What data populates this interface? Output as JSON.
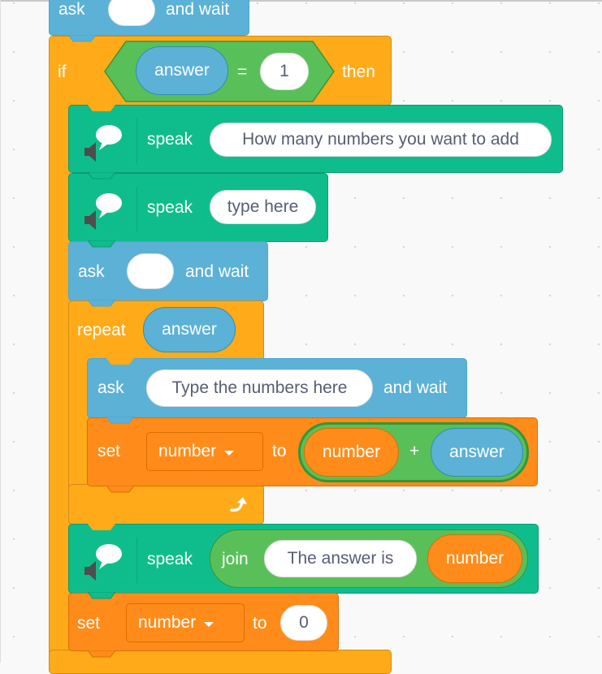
{
  "canvas": {
    "name": "Scratch code area",
    "colors": {
      "control": "#ffab19",
      "sensing": "#5cb1d6",
      "text_to_speech": "#0fbd8c",
      "variables": "#ff8c1a",
      "operators": "#59c059",
      "background": "#f9f9f9"
    }
  },
  "blocks": {
    "ask_top": {
      "ask": "ask",
      "input": "",
      "and_wait": "and wait"
    },
    "if_block": {
      "if": "if",
      "condition": {
        "left": "answer",
        "operator": "=",
        "right": "1"
      },
      "then": "then"
    },
    "speak1": {
      "label": "speak",
      "input": "How many numbers you want to add",
      "icon": "text-to-speech-icon"
    },
    "speak2": {
      "label": "speak",
      "input": "type here",
      "icon": "text-to-speech-icon"
    },
    "ask2": {
      "ask": "ask",
      "input": "",
      "and_wait": "and wait"
    },
    "repeat": {
      "label": "repeat",
      "input": "answer",
      "loop_icon": "loop-arrow-icon"
    },
    "ask3": {
      "ask": "ask",
      "input": "Type the numbers here",
      "and_wait": "and wait"
    },
    "set1": {
      "set": "set",
      "variable": "number",
      "to": "to",
      "expression": {
        "left": "number",
        "operator": "+",
        "right": "answer"
      }
    },
    "speak3": {
      "label": "speak",
      "join": "join",
      "join_left": "The answer is",
      "join_right": "number",
      "icon": "text-to-speech-icon"
    },
    "set2": {
      "set": "set",
      "variable": "number",
      "to": "to",
      "value": "0"
    }
  }
}
